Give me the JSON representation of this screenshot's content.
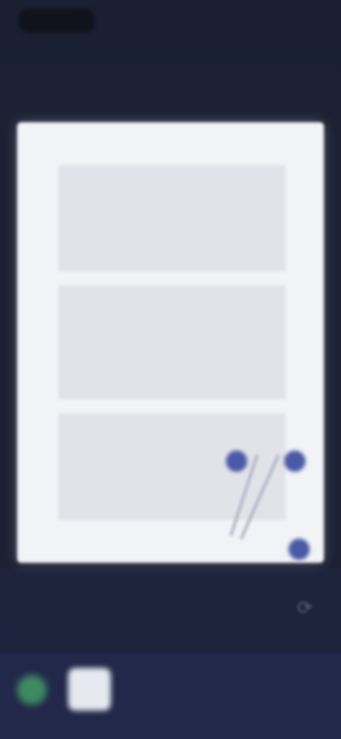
{
  "status_bar": {
    "time": "",
    "indicators": ""
  },
  "toolbar": {
    "left_label": "",
    "center_label": "",
    "right_label": ""
  },
  "bottom": {
    "page_indicator": ""
  },
  "colors": {
    "accent": "#3aa36a",
    "handle": "#4a5aa6"
  }
}
